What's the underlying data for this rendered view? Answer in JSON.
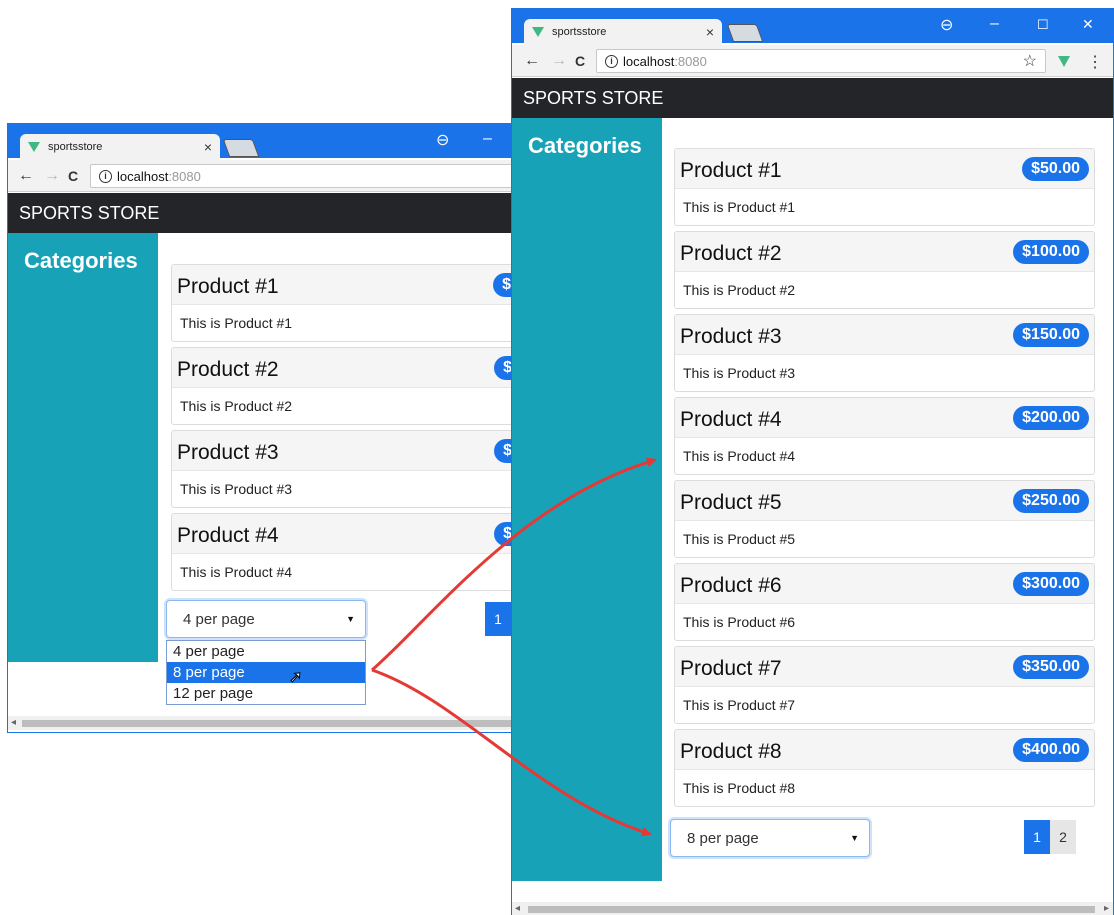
{
  "browser": {
    "tab_title": "sportsstore",
    "tab_close": "×",
    "host": "localhost",
    "port": ":8080",
    "back": "←",
    "forward": "→",
    "reload": "C",
    "info": "i",
    "star": "☆",
    "menu": "⋮",
    "account": "⊖",
    "minimize": "–",
    "maximize": "☐",
    "close": "✕"
  },
  "store": {
    "brand": "SPORTS STORE",
    "sidebar_title": "Categories"
  },
  "products": [
    {
      "name": "Product #1",
      "description": "This is Product #1",
      "price": "$50.00"
    },
    {
      "name": "Product #2",
      "description": "This is Product #2",
      "price": "$100.00"
    },
    {
      "name": "Product #3",
      "description": "This is Product #3",
      "price": "$150.00"
    },
    {
      "name": "Product #4",
      "description": "This is Product #4",
      "price": "$200.00"
    },
    {
      "name": "Product #5",
      "description": "This is Product #5",
      "price": "$250.00"
    },
    {
      "name": "Product #6",
      "description": "This is Product #6",
      "price": "$300.00"
    },
    {
      "name": "Product #7",
      "description": "This is Product #7",
      "price": "$350.00"
    },
    {
      "name": "Product #8",
      "description": "This is Product #8",
      "price": "$400.00"
    }
  ],
  "left_window": {
    "page_size": "4 per page",
    "options": [
      "4 per page",
      "8 per page",
      "12 per page"
    ],
    "highlighted_option": "8 per page",
    "page_buttons": [
      "1"
    ]
  },
  "right_window": {
    "page_size": "8 per page",
    "page_buttons": [
      "1",
      "2"
    ],
    "current_page": "1"
  },
  "colors": {
    "accent": "#1a73e8",
    "sidebar": "#17a2b8",
    "navbar": "#232528",
    "arrow": "#e53935",
    "vue": "#41b883"
  },
  "icons": {
    "caret": "▼",
    "cursor": "➚"
  }
}
